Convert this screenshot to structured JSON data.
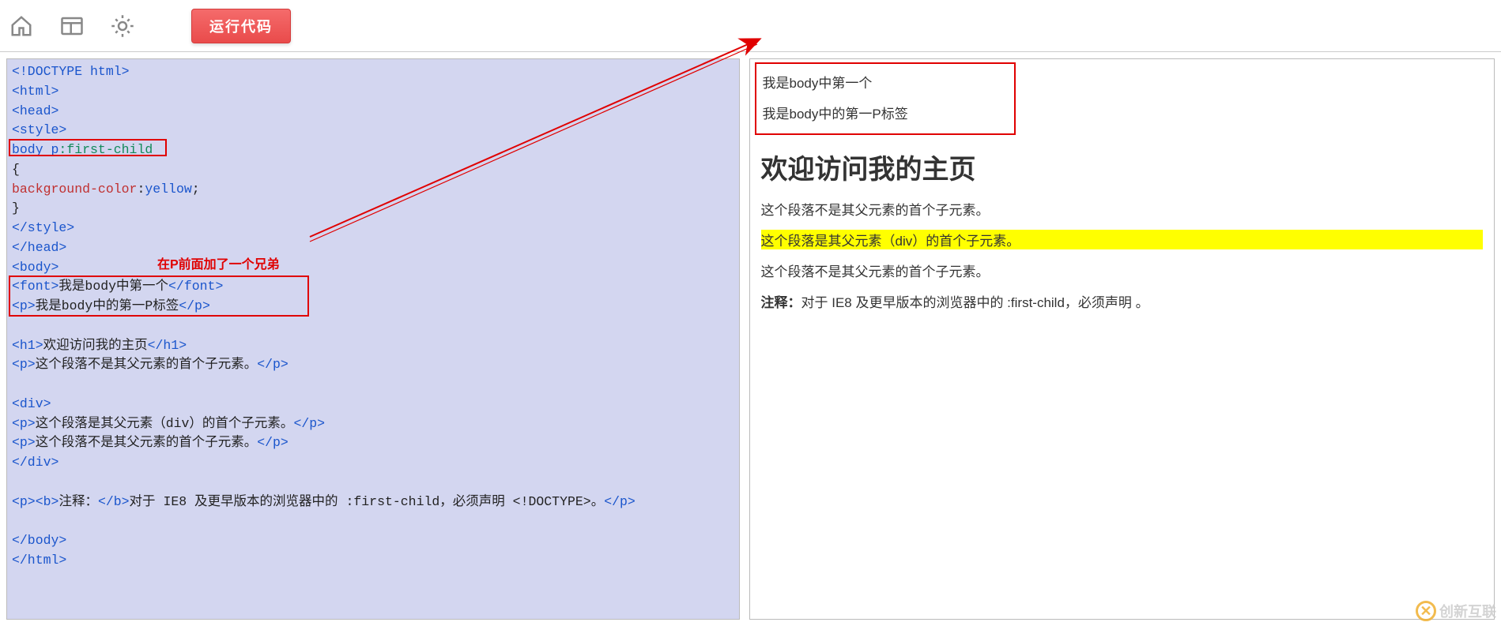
{
  "toolbar": {
    "run_label": "运行代码"
  },
  "annotations": {
    "red_text": "在P前面加了一个兄弟"
  },
  "code": {
    "l1_doctype": "<!DOCTYPE html>",
    "l2_html_open": "<html>",
    "l3_head_open": "<head>",
    "l4_style_open": "<style>",
    "l5_sel_body": "body ",
    "l5_sel_p": "p",
    "l5_sel_pseudo": ":first-child",
    "l6_brace": "{",
    "l7_prop": "background-color",
    "l7_colon": ":",
    "l7_val": "yellow",
    "l7_semi": ";",
    "l8_brace": "}",
    "l9_style_close": "</style>",
    "l10_head_close": "</head>",
    "l11_body_open": "<body>",
    "l12_font_open": "<font>",
    "l12_text": "我是body中第一个",
    "l12_font_close": "</font>",
    "l13_p_open": "<p>",
    "l13_text": "我是body中的第一P标签",
    "l13_p_close": "</p>",
    "l14_h1_open": "<h1>",
    "l14_text": "欢迎访问我的主页",
    "l14_h1_close": "</h1>",
    "l15_p_open": "<p>",
    "l15_text": "这个段落不是其父元素的首个子元素。",
    "l15_p_close": "</p>",
    "l16_div_open": "<div>",
    "l17_p_open": "<p>",
    "l17_text": "这个段落是其父元素（div）的首个子元素。",
    "l17_p_close": "</p>",
    "l18_p_open": "<p>",
    "l18_text": "这个段落不是其父元素的首个子元素。",
    "l18_p_close": "</p>",
    "l19_div_close": "</div>",
    "l20_p_open": "<p>",
    "l20_b_open": "<b>",
    "l20_b_text": "注释：",
    "l20_b_close": "</b>",
    "l20_text": "对于 IE8 及更早版本的浏览器中的 :first-child，必须声明 <!DOCTYPE>。",
    "l20_p_close": "</p>",
    "l21_body_close": "</body>",
    "l22_html_close": "</html>"
  },
  "preview": {
    "font_text": "我是body中第一个",
    "p1_text": "我是body中的第一P标签",
    "h1": "欢迎访问我的主页",
    "p2": "这个段落不是其父元素的首个子元素。",
    "p3": "这个段落是其父元素（div）的首个子元素。",
    "p4": "这个段落不是其父元素的首个子元素。",
    "note_bold": "注释：",
    "note_text": "对于 IE8 及更早版本的浏览器中的 :first-child，必须声明 。"
  },
  "watermark": {
    "text": "创新互联",
    "icon_glyph": "✕"
  }
}
